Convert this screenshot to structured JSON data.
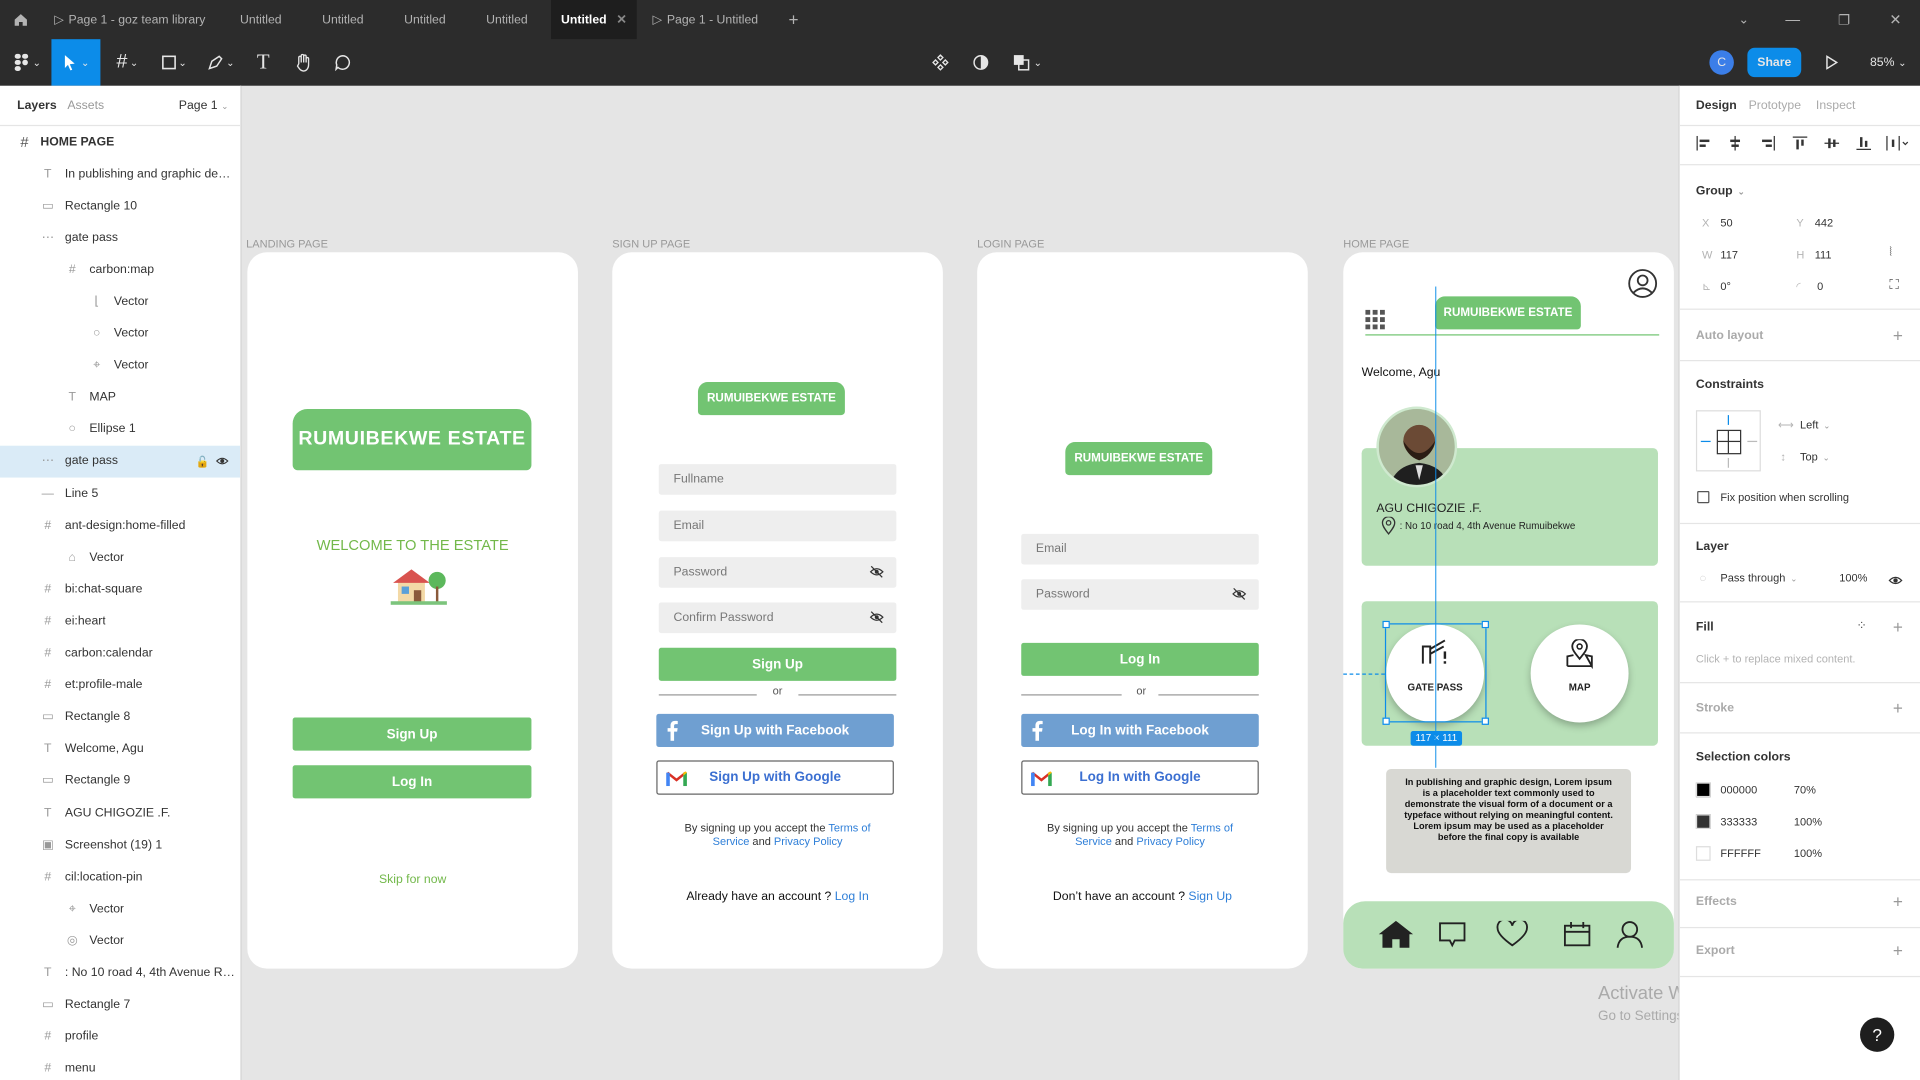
{
  "tabs": [
    {
      "label": "Page 1 - goz team library",
      "prefix": "▷"
    },
    {
      "label": "Untitled"
    },
    {
      "label": "Untitled"
    },
    {
      "label": "Untitled"
    },
    {
      "label": "Untitled"
    },
    {
      "label": "Untitled",
      "active": true
    },
    {
      "label": "Page 1 - Untitled",
      "prefix": "▷"
    }
  ],
  "toolbar": {
    "avatar": "C",
    "share": "Share",
    "zoom": "85%"
  },
  "left_panel": {
    "tab_layers": "Layers",
    "tab_assets": "Assets",
    "page": "Page 1",
    "root": "HOME PAGE",
    "layers": [
      {
        "label": "In publishing and graphic desi...",
        "icon": "T"
      },
      {
        "label": "Rectangle 10",
        "icon": "▭"
      },
      {
        "label": "gate pass",
        "icon": "⋯"
      },
      {
        "label": "carbon:map",
        "icon": "#",
        "indent": 1
      },
      {
        "label": "Vector",
        "icon": "⌊",
        "indent": 2
      },
      {
        "label": "Vector",
        "icon": "○",
        "indent": 2
      },
      {
        "label": "Vector",
        "icon": "⌖",
        "indent": 2
      },
      {
        "label": "MAP",
        "icon": "T",
        "indent": 1
      },
      {
        "label": "Ellipse 1",
        "icon": "○",
        "indent": 1
      },
      {
        "label": "gate pass",
        "icon": "⋯",
        "selected": true
      },
      {
        "label": "Line 5",
        "icon": "—"
      },
      {
        "label": "ant-design:home-filled",
        "icon": "#"
      },
      {
        "label": "Vector",
        "icon": "⌂",
        "indent": 1
      },
      {
        "label": "bi:chat-square",
        "icon": "#"
      },
      {
        "label": "ei:heart",
        "icon": "#"
      },
      {
        "label": "carbon:calendar",
        "icon": "#"
      },
      {
        "label": "et:profile-male",
        "icon": "#"
      },
      {
        "label": "Rectangle 8",
        "icon": "▭"
      },
      {
        "label": "Welcome, Agu",
        "icon": "T"
      },
      {
        "label": "Rectangle 9",
        "icon": "▭"
      },
      {
        "label": "AGU CHIGOZIE .F.",
        "icon": "T"
      },
      {
        "label": "Screenshot (19) 1",
        "icon": "▣"
      },
      {
        "label": "cil:location-pin",
        "icon": "#"
      },
      {
        "label": "Vector",
        "icon": "⌖",
        "indent": 1
      },
      {
        "label": "Vector",
        "icon": "◎",
        "indent": 1
      },
      {
        "label": ": No 10 road 4, 4th Avenue Ru...",
        "icon": "T"
      },
      {
        "label": "Rectangle 7",
        "icon": "▭"
      },
      {
        "label": "profile",
        "icon": "#"
      },
      {
        "label": "menu",
        "icon": "#"
      }
    ]
  },
  "canvas": {
    "landing": {
      "frame_label": "LANDING PAGE",
      "logo": "RUMUIBEKWE ESTATE",
      "welcome": "WELCOME TO THE ESTATE",
      "signup": "Sign Up",
      "login": "Log In",
      "skip": "Skip for now"
    },
    "signup": {
      "frame_label": "SIGN UP PAGE",
      "logo": "RUMUIBEKWE ESTATE",
      "fullname": "Fullname",
      "email": "Email",
      "password": "Password",
      "confirm": "Confirm Password",
      "button": "Sign Up",
      "or": "or",
      "facebook": "Sign Up with Facebook",
      "google": "Sign Up with Google",
      "terms_pre": "By signing up you accept the ",
      "terms_link": "Terms of Service",
      "terms_and": " and ",
      "privacy": "Privacy Policy",
      "account_q": "Already have an account ? ",
      "account_link": "Log In"
    },
    "login": {
      "frame_label": "LOGIN PAGE",
      "logo": "RUMUIBEKWE ESTATE",
      "email": "Email",
      "password": "Password",
      "button": "Log In",
      "or": "or",
      "facebook": "Log In with Facebook",
      "google": "Log In with Google",
      "terms_pre": "By signing up you accept the ",
      "terms_link": "Terms of Service",
      "terms_and": " and ",
      "privacy": "Privacy Policy",
      "account_q": "Don’t have an account ? ",
      "account_link": "Sign Up"
    },
    "home": {
      "frame_label": "HOME PAGE",
      "logo": "RUMUIBEKWE ESTATE",
      "welcome": "Welcome, Agu",
      "name": "AGU CHIGOZIE .F.",
      "address": ": No 10 road 4, 4th Avenue Rumuibekwe",
      "gate_pass": "GATE PASS",
      "map": "MAP",
      "size_badge": "117 × 111",
      "lorem": "In publishing and graphic design, Lorem ipsum is a placeholder text commonly used to demonstrate the visual form of a document or a typeface without relying on meaningful content. Lorem ipsum may be used as a placeholder before the final copy is available"
    },
    "watermark_title": "Activate Windows",
    "watermark_sub": "Go to Settings to activate Windows."
  },
  "right_panel": {
    "tab_design": "Design",
    "tab_prototype": "Prototype",
    "tab_inspect": "Inspect",
    "group": "Group",
    "x_label": "X",
    "x": "50",
    "y_label": "Y",
    "y": "442",
    "w_label": "W",
    "w": "117",
    "h_label": "H",
    "h": "111",
    "rotation": "0°",
    "radius": "0",
    "auto_layout": "Auto layout",
    "constraints": "Constraints",
    "constraint_h": "Left",
    "constraint_v": "Top",
    "fix_position": "Fix position when scrolling",
    "layer": "Layer",
    "blend": "Pass through",
    "opacity": "100%",
    "fill": "Fill",
    "fill_hint": "Click + to replace mixed content.",
    "stroke": "Stroke",
    "selection_colors": "Selection colors",
    "colors": [
      {
        "hex": "000000",
        "opacity": "70%",
        "swatch": "#000000"
      },
      {
        "hex": "333333",
        "opacity": "100%",
        "swatch": "#333333"
      },
      {
        "hex": "FFFFFF",
        "opacity": "100%",
        "swatch": "#ffffff"
      }
    ],
    "effects": "Effects",
    "export": "Export"
  },
  "colors": {
    "accent_blue": "#0c8ce9",
    "estate_green": "#72c472",
    "card_green": "#b8e0b8",
    "canvas_bg": "#e5e5e5"
  }
}
